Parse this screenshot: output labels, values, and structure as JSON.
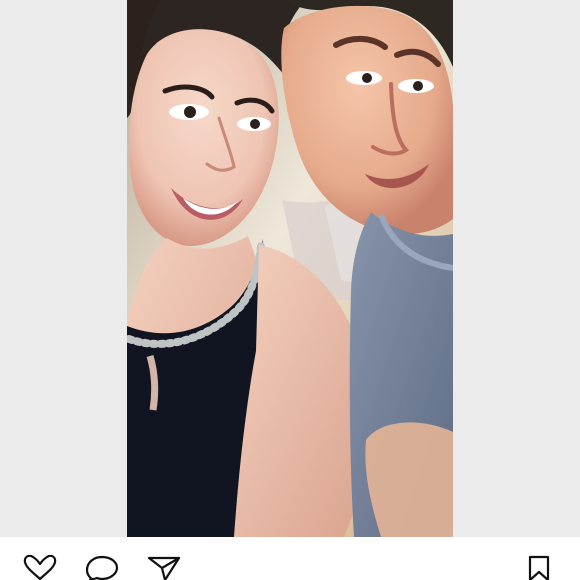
{
  "post": {
    "image_description": "",
    "accent": {
      "background": "#ebebeb",
      "icon": "#111111",
      "dress": "#111522",
      "shirt": "#6f7d95"
    }
  },
  "actions": {
    "like": {
      "icon": "heart-icon"
    },
    "comment": {
      "icon": "comment-bubble-icon"
    },
    "share": {
      "icon": "paper-plane-icon"
    },
    "save": {
      "icon": "bookmark-icon"
    }
  }
}
